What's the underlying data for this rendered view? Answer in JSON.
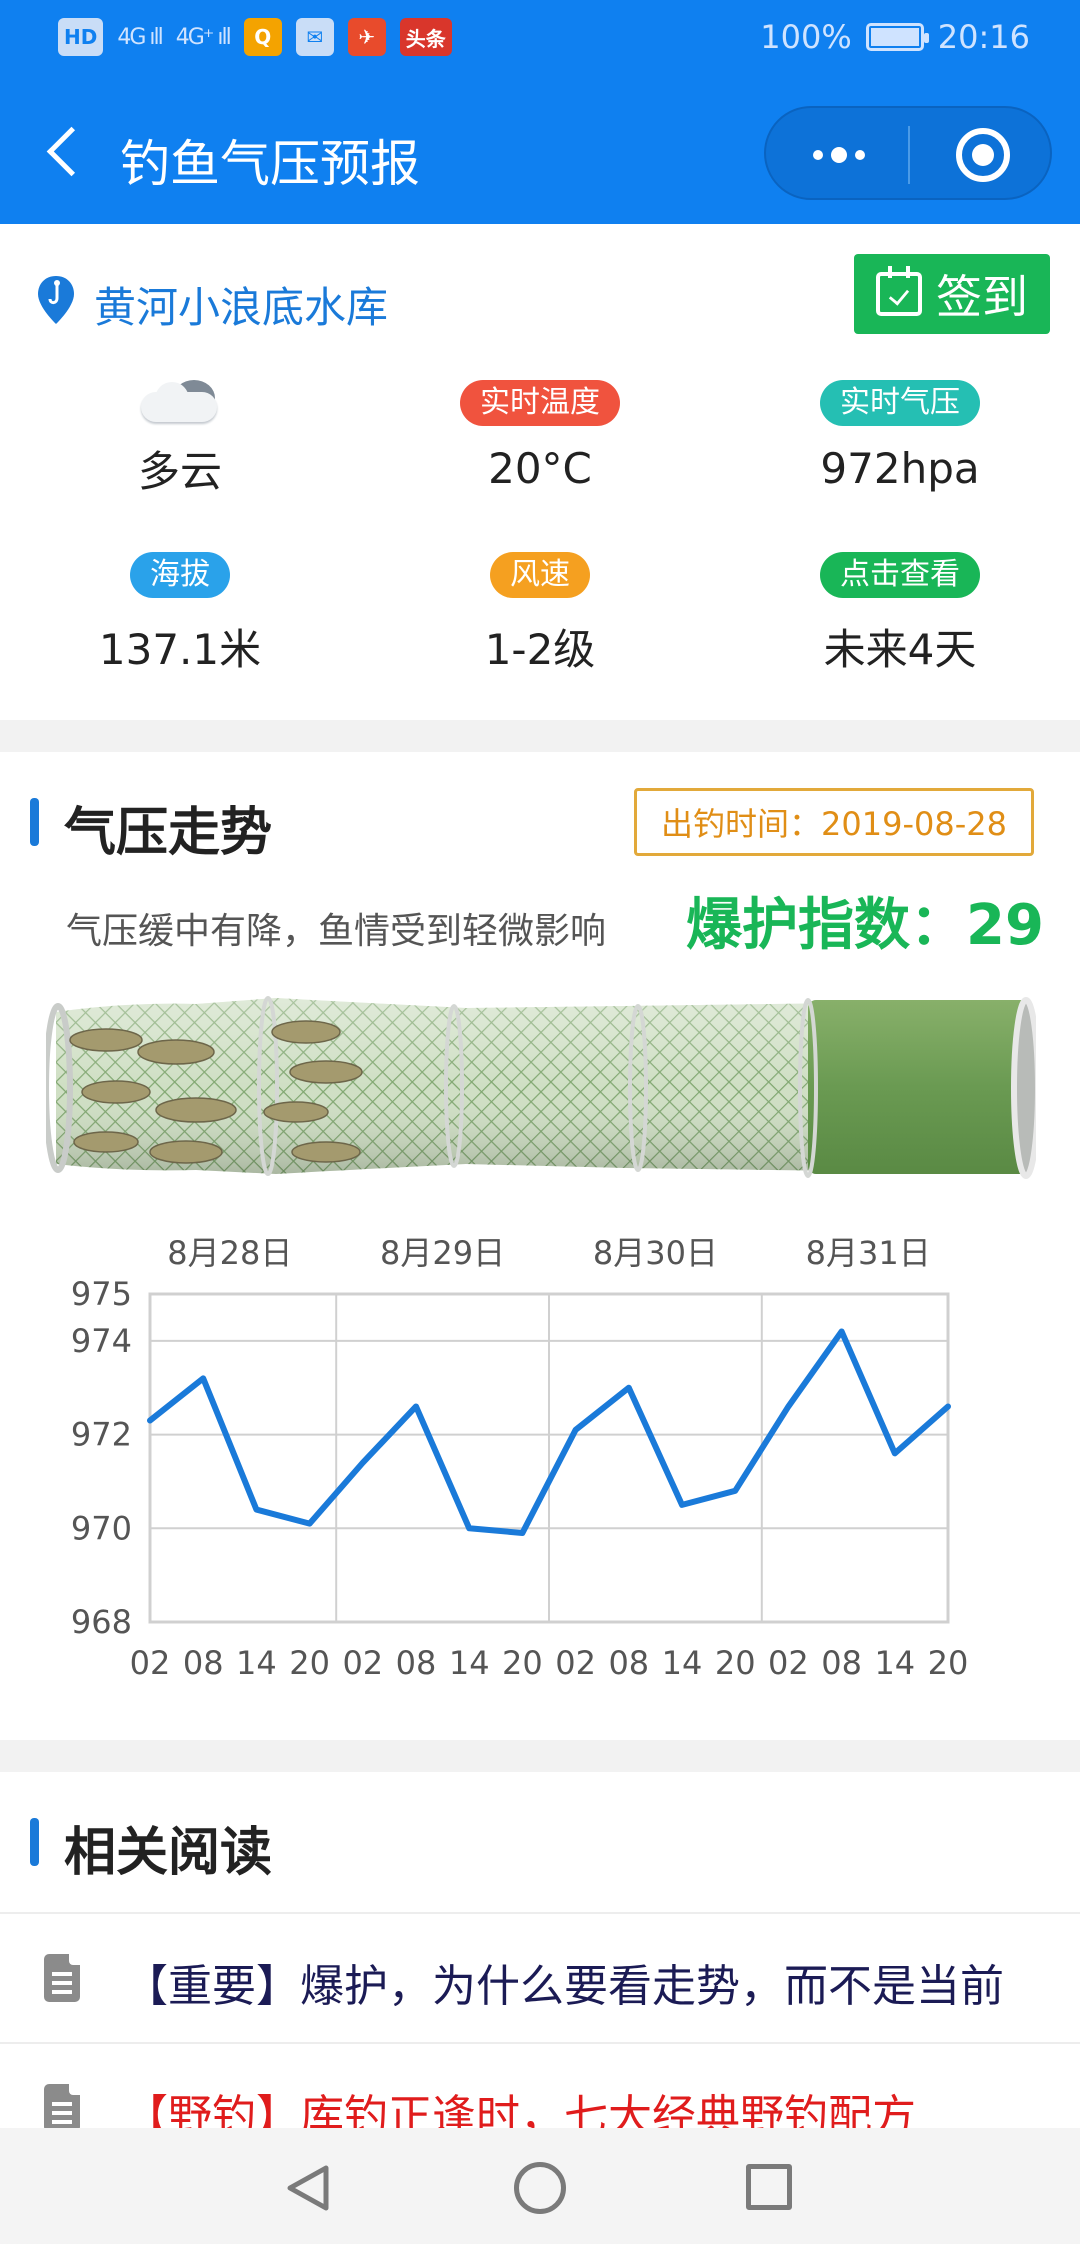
{
  "status_bar": {
    "left_chips": [
      "HD",
      "Q",
      "✉",
      "头条"
    ],
    "sig1": "4G ıll",
    "sig2": "4G⁺ ıll",
    "battery": "100%",
    "time": "20:16"
  },
  "nav": {
    "title": "钓鱼气压预报"
  },
  "location": {
    "name": "黄河小浪底水库",
    "checkin_label": "签到"
  },
  "stats": [
    {
      "label": "",
      "value": "多云",
      "icon": "cloudy-icon",
      "color": ""
    },
    {
      "label": "实时温度",
      "value": "20°C",
      "color": "#f0533e"
    },
    {
      "label": "实时气压",
      "value": "972hpa",
      "color": "#25bfb3"
    },
    {
      "label": "海拔",
      "value": "137.1米",
      "color": "#2aa2ea"
    },
    {
      "label": "风速",
      "value": "1-2级",
      "color": "#f5a020"
    },
    {
      "label": "点击查看",
      "value": "未来4天",
      "color": "#19b657"
    }
  ],
  "trend": {
    "title": "气压走势",
    "time_label": "出钓时间：2019-08-28",
    "description": "气压缓中有降，鱼情受到轻微影响",
    "index_label": "爆护指数：29",
    "index_value": 29
  },
  "chart_data": {
    "type": "line",
    "title": "",
    "xlabel": "",
    "ylabel": "",
    "day_labels": [
      "8月28日",
      "8月29日",
      "8月30日",
      "8月31日"
    ],
    "categories": [
      "02",
      "08",
      "14",
      "20",
      "02",
      "08",
      "14",
      "20",
      "02",
      "08",
      "14",
      "20",
      "02",
      "08",
      "14",
      "20"
    ],
    "values": [
      972.3,
      973.2,
      970.4,
      970.1,
      971.4,
      972.6,
      970.0,
      969.9,
      972.1,
      973.0,
      970.5,
      970.8,
      972.6,
      974.2,
      971.6,
      972.6
    ],
    "ylim": [
      968,
      975
    ],
    "yticks": [
      968,
      970,
      972,
      974,
      975
    ],
    "grid": true,
    "line_color": "#1a7ad9"
  },
  "reading": {
    "title": "相关阅读",
    "items": [
      {
        "tag": "【重要】",
        "text": "爆护，为什么要看走势，而不是当前"
      },
      {
        "tag": "【野钓】",
        "text": "库钓正逢时，七大经典野钓配方"
      }
    ]
  }
}
